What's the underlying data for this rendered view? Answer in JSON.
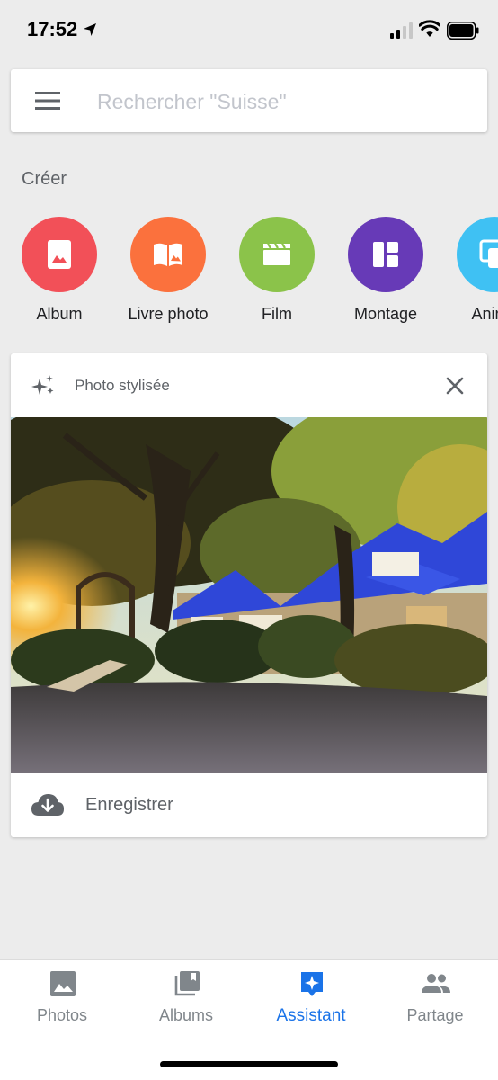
{
  "status_bar": {
    "time": "17:52",
    "icons": [
      "location-arrow-icon",
      "cellular-signal-icon",
      "wifi-icon",
      "battery-icon"
    ]
  },
  "search": {
    "placeholder": "Rechercher \"Suisse\"",
    "value": "",
    "menu_icon": "hamburger-menu-icon"
  },
  "create": {
    "title": "Créer",
    "items": [
      {
        "label": "Album",
        "icon": "album-icon",
        "color": "#f25058"
      },
      {
        "label": "Livre photo",
        "icon": "photo-book-icon",
        "color": "#fb713d"
      },
      {
        "label": "Film",
        "icon": "film-icon",
        "color": "#8bc34a"
      },
      {
        "label": "Montage",
        "icon": "collage-icon",
        "color": "#673ab7"
      },
      {
        "label": "Anima",
        "icon": "animation-icon",
        "color": "#3fc1f3"
      }
    ]
  },
  "card": {
    "title": "Photo stylisée",
    "header_icon": "sparkle-icon",
    "close_icon": "close-icon",
    "save_label": "Enregistrer",
    "save_icon": "cloud-download-icon"
  },
  "bottom_nav": {
    "active_index": 2,
    "active_color": "#1a73e8",
    "inactive_color": "#80868b",
    "items": [
      {
        "label": "Photos",
        "icon": "photos-icon"
      },
      {
        "label": "Albums",
        "icon": "albums-icon"
      },
      {
        "label": "Assistant",
        "icon": "assistant-icon"
      },
      {
        "label": "Partage",
        "icon": "sharing-icon"
      }
    ]
  }
}
